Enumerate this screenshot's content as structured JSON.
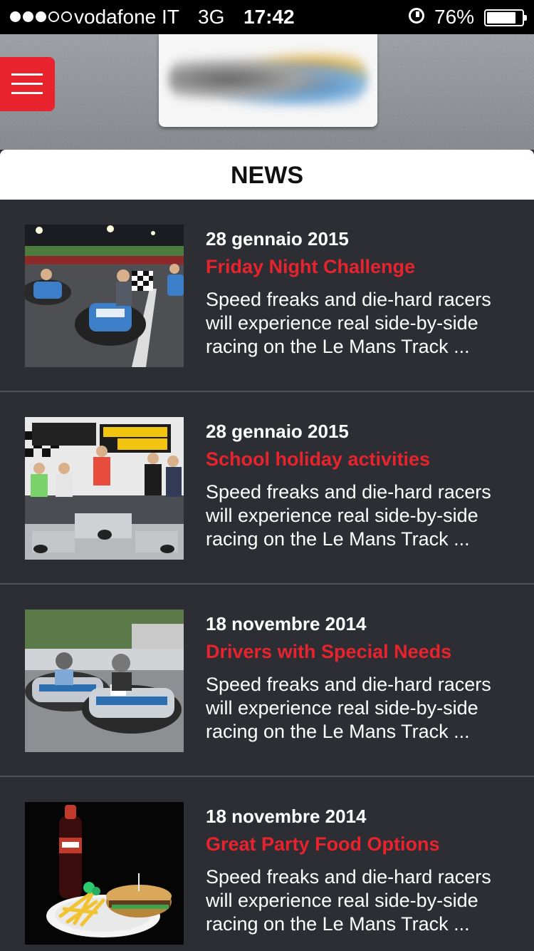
{
  "status_bar": {
    "carrier": "vodafone IT",
    "network": "3G",
    "time": "17:42",
    "battery": "76%",
    "battery_level": 0.76,
    "signal_bars": 3,
    "icons": [
      "signal-icon",
      "alarm-icon",
      "battery-icon"
    ]
  },
  "header": {
    "menu_icon": "hamburger-menu-icon",
    "logo": "blurred-logo"
  },
  "section_title": "NEWS",
  "news": [
    {
      "date": "28 gennaio 2015",
      "title": "Friday Night Challenge",
      "excerpt": "Speed freaks and die-hard racers will experience real side-by-side racing on the Le Mans Track ..."
    },
    {
      "date": "28 gennaio 2015",
      "title": "School holiday activities",
      "excerpt": "Speed freaks and die-hard racers will experience real side-by-side racing on the Le Mans Track ..."
    },
    {
      "date": "18 novembre 2014",
      "title": "Drivers with Special Needs",
      "excerpt": "Speed freaks and die-hard racers will experience real side-by-side racing on the Le Mans Track ..."
    },
    {
      "date": "18 novembre 2014",
      "title": "Great Party Food Options",
      "excerpt": "Speed freaks and die-hard racers will experience real side-by-side racing on the Le Mans Track ..."
    }
  ],
  "colors": {
    "accent": "#e8232e",
    "background": "#2c2e33",
    "text": "#ffffff"
  }
}
